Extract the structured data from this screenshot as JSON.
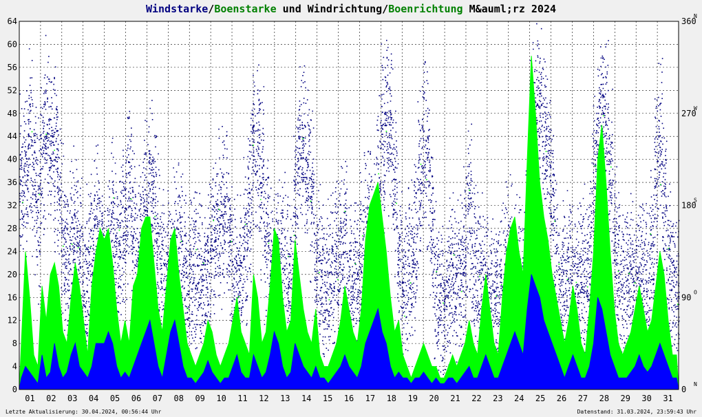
{
  "title": {
    "part1": "Windstarke",
    "sep1": "/",
    "part2": "Boenstarke",
    "part3": " und Windrichtung",
    "sep2": "/",
    "part4": "Boenrichtung",
    "part5": " M&auml;rz 2024"
  },
  "colors": {
    "wind": "#0000ff",
    "gust": "#00ff00",
    "direction": "#000080",
    "gust_direction": "#00ff00",
    "grid": "#000000",
    "background": "#ffffff",
    "title_dark": "#000080",
    "title_green": "#008000"
  },
  "footer": {
    "left": "Letzte Aktualisierung: 30.04.2024, 00:56:44 Uhr",
    "right": "Datenstand: 31.03.2024, 23:59:43 Uhr"
  },
  "chart_data": {
    "type": "area",
    "days": [
      "01",
      "02",
      "03",
      "04",
      "05",
      "06",
      "07",
      "08",
      "09",
      "10",
      "11",
      "12",
      "13",
      "14",
      "15",
      "16",
      "17",
      "18",
      "19",
      "20",
      "21",
      "22",
      "23",
      "24",
      "25",
      "26",
      "27",
      "28",
      "29",
      "30",
      "31"
    ],
    "ylim_left": [
      0,
      64
    ],
    "yticks_left": [
      "0",
      "4",
      "8",
      "12",
      "16",
      "20",
      "24",
      "28",
      "32",
      "36",
      "40",
      "44",
      "48",
      "52",
      "56",
      "60",
      "64"
    ],
    "ylim_right": [
      0,
      360
    ],
    "yticks_right": [
      "0",
      "90",
      "180",
      "270",
      "360"
    ],
    "compass_labels": [
      "N",
      "O",
      "S",
      "W",
      "N"
    ],
    "grid": true,
    "series": [
      {
        "name": "Windstarke",
        "values": [
          2,
          4,
          3,
          2,
          1,
          6,
          2,
          3,
          8,
          4,
          2,
          3,
          6,
          8,
          4,
          3,
          2,
          4,
          8,
          8,
          8,
          10,
          8,
          4,
          2,
          3,
          2,
          4,
          6,
          8,
          10,
          12,
          8,
          4,
          2,
          6,
          10,
          12,
          8,
          4,
          2,
          2,
          1,
          2,
          3,
          5,
          3,
          2,
          1,
          2,
          2,
          4,
          6,
          3,
          2,
          2,
          6,
          4,
          2,
          3,
          6,
          10,
          8,
          4,
          2,
          3,
          8,
          6,
          4,
          3,
          2,
          4,
          2,
          2,
          1,
          2,
          3,
          4,
          6,
          4,
          3,
          2,
          4,
          8,
          10,
          12,
          14,
          10,
          8,
          4,
          2,
          3,
          2,
          2,
          1,
          2,
          2,
          3,
          2,
          1,
          2,
          1,
          1,
          2,
          2,
          1,
          2,
          3,
          4,
          2,
          2,
          4,
          6,
          4,
          2,
          2,
          4,
          6,
          8,
          10,
          8,
          6,
          14,
          20,
          18,
          16,
          12,
          10,
          8,
          6,
          4,
          2,
          4,
          6,
          4,
          2,
          2,
          4,
          8,
          16,
          14,
          10,
          6,
          4,
          2,
          2,
          2,
          3,
          4,
          6,
          4,
          3,
          4,
          6,
          8,
          6,
          4,
          2,
          2
        ]
      },
      {
        "name": "Boenstarke",
        "values": [
          8,
          24,
          16,
          6,
          4,
          18,
          12,
          20,
          22,
          18,
          10,
          8,
          16,
          22,
          18,
          12,
          6,
          18,
          24,
          28,
          26,
          28,
          22,
          14,
          8,
          12,
          8,
          18,
          20,
          28,
          30,
          30,
          22,
          14,
          10,
          18,
          26,
          28,
          20,
          14,
          8,
          6,
          4,
          6,
          8,
          12,
          10,
          6,
          4,
          6,
          8,
          12,
          16,
          10,
          8,
          6,
          20,
          16,
          8,
          10,
          18,
          28,
          26,
          16,
          10,
          12,
          26,
          20,
          14,
          10,
          8,
          14,
          6,
          4,
          4,
          6,
          8,
          12,
          18,
          14,
          10,
          8,
          14,
          26,
          32,
          34,
          36,
          30,
          24,
          16,
          10,
          12,
          6,
          4,
          2,
          4,
          6,
          8,
          6,
          4,
          4,
          2,
          2,
          4,
          6,
          4,
          6,
          8,
          12,
          8,
          6,
          14,
          20,
          14,
          8,
          6,
          16,
          24,
          28,
          30,
          24,
          20,
          40,
          58,
          48,
          36,
          30,
          26,
          20,
          16,
          12,
          8,
          12,
          18,
          14,
          8,
          6,
          14,
          24,
          40,
          46,
          36,
          24,
          14,
          8,
          6,
          8,
          10,
          14,
          18,
          14,
          10,
          12,
          18,
          24,
          20,
          12,
          6,
          6
        ]
      },
      {
        "name": "Windrichtung",
        "values": [
          200,
          220,
          250,
          210,
          180,
          230,
          260,
          240,
          230,
          200,
          150,
          120,
          140,
          160,
          120,
          100,
          110,
          130,
          150,
          140,
          100,
          130,
          160,
          140,
          150,
          170,
          200,
          160,
          130,
          150,
          170,
          200,
          190,
          140,
          110,
          100,
          110,
          130,
          140,
          120,
          100,
          110,
          120,
          110,
          100,
          120,
          150,
          160,
          170,
          180,
          150,
          110,
          100,
          110,
          140,
          180,
          240,
          230,
          200,
          160,
          120,
          110,
          120,
          130,
          110,
          100,
          180,
          230,
          240,
          220,
          190,
          120,
          110,
          100,
          100,
          110,
          120,
          130,
          150,
          110,
          100,
          110,
          130,
          150,
          160,
          140,
          200,
          240,
          260,
          250,
          200,
          130,
          100,
          110,
          120,
          140,
          200,
          240,
          220,
          150,
          100,
          90,
          80,
          100,
          120,
          100,
          110,
          140,
          180,
          120,
          100,
          100,
          110,
          90,
          80,
          90,
          100,
          110,
          120,
          110,
          100,
          100,
          140,
          250,
          270,
          280,
          250,
          230,
          180,
          120,
          100,
          100,
          110,
          100,
          90,
          100,
          110,
          130,
          200,
          240,
          270,
          250,
          200,
          150,
          110,
          100,
          100,
          110,
          100,
          100,
          110,
          100,
          130,
          200,
          230,
          180,
          120,
          100,
          100
        ]
      }
    ]
  }
}
